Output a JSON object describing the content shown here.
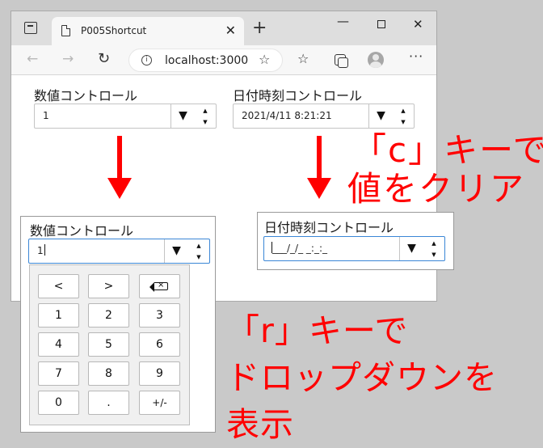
{
  "browser": {
    "tab_title": "P005Shortcut",
    "address": "localhost:3000",
    "new_tab": "+",
    "tab_close": "✕",
    "minimize": "—",
    "close": "✕",
    "back": "←",
    "forward": "→",
    "reload": "↻",
    "info": "i",
    "favorites": "☆",
    "add_favorite": "☆",
    "more": "···"
  },
  "numeric_control": {
    "label": "数値コントロール",
    "value": "1",
    "dropdown_glyph": "▼",
    "spin_up": "▲",
    "spin_down": "▼"
  },
  "datetime_control": {
    "label": "日付時刻コントロール",
    "value": "2021/4/11 8:21:21",
    "dropdown_glyph": "▼",
    "spin_up": "▲",
    "spin_down": "▼"
  },
  "zoom_numeric": {
    "label": "数値コントロール",
    "value": "1",
    "dropdown_glyph": "▼",
    "spin_up": "▲",
    "spin_down": "▼",
    "keys": {
      "left": "<",
      "right": ">",
      "k1": "1",
      "k2": "2",
      "k3": "3",
      "k4": "4",
      "k5": "5",
      "k6": "6",
      "k7": "7",
      "k8": "8",
      "k9": "9",
      "k0": "0",
      "dot": ".",
      "sign": "+/-"
    }
  },
  "zoom_datetime": {
    "label": "日付時刻コントロール",
    "value": "___/_/_ _:_:_",
    "dropdown_glyph": "▼",
    "spin_up": "▲",
    "spin_down": "▼"
  },
  "annotations": {
    "c_line1": "「c」キーで",
    "c_line2": "値をクリア",
    "r_line1": "「r」キーで",
    "r_line2": "ドロップダウンを",
    "r_line3": "表示"
  },
  "colors": {
    "annotation": "#ff0000",
    "focus_border": "#3a86d6"
  }
}
